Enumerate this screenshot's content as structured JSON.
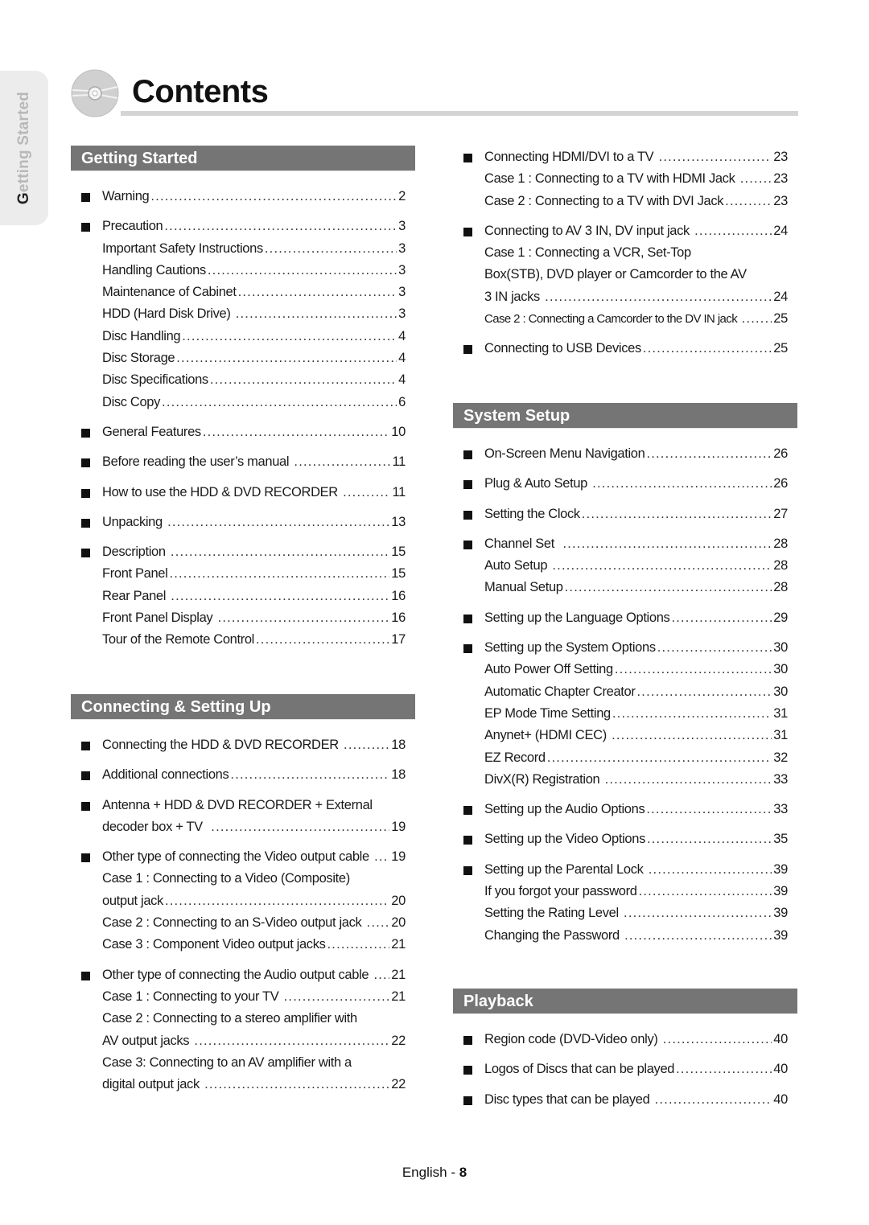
{
  "side_tab": {
    "first_letter": "G",
    "rest": "etting Started"
  },
  "title": "Contents",
  "columns": [
    {
      "sections": [
        {
          "header": "Getting Started",
          "groups": [
            {
              "lines": [
                {
                  "bullet": true,
                  "text": "Warning",
                  "page": "2"
                }
              ]
            },
            {
              "lines": [
                {
                  "bullet": true,
                  "text": "Precaution",
                  "page": "3"
                },
                {
                  "bullet": false,
                  "text": "Important Safety Instructions",
                  "page": "3"
                },
                {
                  "bullet": false,
                  "text": "Handling Cautions",
                  "page": "3"
                },
                {
                  "bullet": false,
                  "text": "Maintenance of Cabinet",
                  "page": "3"
                },
                {
                  "bullet": false,
                  "text": "HDD (Hard Disk Drive) ",
                  "page": "3"
                },
                {
                  "bullet": false,
                  "text": "Disc Handling",
                  "page": "4"
                },
                {
                  "bullet": false,
                  "text": "Disc Storage",
                  "page": "4"
                },
                {
                  "bullet": false,
                  "text": "Disc Specifications",
                  "page": "4"
                },
                {
                  "bullet": false,
                  "text": "Disc Copy",
                  "page": "6"
                }
              ]
            },
            {
              "lines": [
                {
                  "bullet": true,
                  "text": "General Features",
                  "page": "10"
                }
              ]
            },
            {
              "lines": [
                {
                  "bullet": true,
                  "text": "Before reading the user’s manual ",
                  "page": "11"
                }
              ]
            },
            {
              "lines": [
                {
                  "bullet": true,
                  "text": "How to use the HDD & DVD RECORDER ",
                  "page": "11"
                }
              ]
            },
            {
              "lines": [
                {
                  "bullet": true,
                  "text": "Unpacking ",
                  "page": "13"
                }
              ]
            },
            {
              "lines": [
                {
                  "bullet": true,
                  "text": "Description ",
                  "page": "15"
                },
                {
                  "bullet": false,
                  "text": "Front Panel",
                  "page": "15"
                },
                {
                  "bullet": false,
                  "text": "Rear Panel ",
                  "page": "16"
                },
                {
                  "bullet": false,
                  "text": "Front Panel Display ",
                  "page": "16"
                },
                {
                  "bullet": false,
                  "text": "Tour of the Remote Control",
                  "page": "17"
                }
              ]
            }
          ]
        },
        {
          "header": "Connecting & Setting Up",
          "groups": [
            {
              "lines": [
                {
                  "bullet": true,
                  "text": "Connecting the HDD & DVD RECORDER ",
                  "page": "18"
                }
              ]
            },
            {
              "lines": [
                {
                  "bullet": true,
                  "text": "Additional connections",
                  "page": "18"
                }
              ]
            },
            {
              "lines": [
                {
                  "bullet": true,
                  "text": "Antenna + HDD & DVD RECORDER + External",
                  "page": ""
                },
                {
                  "bullet": false,
                  "text": "decoder box + TV  ",
                  "page": "19"
                }
              ]
            },
            {
              "lines": [
                {
                  "bullet": true,
                  "text": "Other type of connecting the Video output cable ",
                  "page": "19"
                },
                {
                  "bullet": false,
                  "text": "Case 1 : Connecting to a Video (Composite)",
                  "page": ""
                },
                {
                  "bullet": false,
                  "text": "output jack",
                  "page": "20"
                },
                {
                  "bullet": false,
                  "text": "Case 2 : Connecting to an S-Video output jack ",
                  "page": "20"
                },
                {
                  "bullet": false,
                  "text": "Case 3 : Component Video output jacks",
                  "page": "21"
                }
              ]
            },
            {
              "lines": [
                {
                  "bullet": true,
                  "text": "Other type of connecting the Audio output cable ",
                  "page": "21"
                },
                {
                  "bullet": false,
                  "text": "Case 1 : Connecting to your TV ",
                  "page": "21"
                },
                {
                  "bullet": false,
                  "text": "Case 2 : Connecting to a stereo amplifier with",
                  "page": ""
                },
                {
                  "bullet": false,
                  "text": "AV output jacks ",
                  "page": "22"
                },
                {
                  "bullet": false,
                  "text": "Case 3: Connecting to an AV amplifier with a",
                  "page": ""
                },
                {
                  "bullet": false,
                  "text": "digital output jack ",
                  "page": "22"
                }
              ]
            }
          ]
        }
      ]
    },
    {
      "sections": [
        {
          "header": "",
          "groups": [
            {
              "lines": [
                {
                  "bullet": true,
                  "text": "Connecting HDMI/DVI to a TV ",
                  "page": "23"
                },
                {
                  "bullet": false,
                  "text": "Case 1 : Connecting to a TV with HDMI Jack ",
                  "page": "23"
                },
                {
                  "bullet": false,
                  "text": "Case 2 : Connecting to a TV with DVI Jack",
                  "page": "23"
                }
              ]
            },
            {
              "lines": [
                {
                  "bullet": true,
                  "text": "Connecting to AV 3 IN, DV input jack ",
                  "page": "24"
                },
                {
                  "bullet": false,
                  "text": "Case 1 : Connecting a VCR, Set-Top",
                  "page": ""
                },
                {
                  "bullet": false,
                  "text": "Box(STB), DVD player or Camcorder to the AV",
                  "page": ""
                },
                {
                  "bullet": false,
                  "text": "3 IN jacks ",
                  "page": "24"
                },
                {
                  "bullet": false,
                  "text": "Case 2 : Connecting a Camcorder to the DV IN jack ",
                  "page": "25",
                  "condensed": true
                }
              ]
            },
            {
              "lines": [
                {
                  "bullet": true,
                  "text": "Connecting to USB Devices",
                  "page": "25"
                }
              ]
            }
          ]
        },
        {
          "header": "System Setup",
          "groups": [
            {
              "lines": [
                {
                  "bullet": true,
                  "text": "On-Screen Menu Navigation",
                  "page": "26"
                }
              ]
            },
            {
              "lines": [
                {
                  "bullet": true,
                  "text": "Plug & Auto Setup ",
                  "page": "26"
                }
              ]
            },
            {
              "lines": [
                {
                  "bullet": true,
                  "text": "Setting the Clock",
                  "page": "27"
                }
              ]
            },
            {
              "lines": [
                {
                  "bullet": true,
                  "text": "Channel Set  ",
                  "page": "28"
                },
                {
                  "bullet": false,
                  "text": "Auto Setup ",
                  "page": "28"
                },
                {
                  "bullet": false,
                  "text": "Manual Setup",
                  "page": "28"
                }
              ]
            },
            {
              "lines": [
                {
                  "bullet": true,
                  "text": "Setting up the Language Options",
                  "page": "29"
                }
              ]
            },
            {
              "lines": [
                {
                  "bullet": true,
                  "text": "Setting up the System Options",
                  "page": "30"
                },
                {
                  "bullet": false,
                  "text": "Auto Power Off Setting",
                  "page": "30"
                },
                {
                  "bullet": false,
                  "text": "Automatic Chapter Creator",
                  "page": "30"
                },
                {
                  "bullet": false,
                  "text": "EP Mode Time Setting",
                  "page": "31"
                },
                {
                  "bullet": false,
                  "text": "Anynet+ (HDMI CEC) ",
                  "page": "31"
                },
                {
                  "bullet": false,
                  "text": "EZ Record",
                  "page": "32"
                },
                {
                  "bullet": false,
                  "text": "DivX(R) Registration ",
                  "page": "33"
                }
              ]
            },
            {
              "lines": [
                {
                  "bullet": true,
                  "text": "Setting up the Audio Options",
                  "page": "33"
                }
              ]
            },
            {
              "lines": [
                {
                  "bullet": true,
                  "text": "Setting up the Video Options",
                  "page": "35"
                }
              ]
            },
            {
              "lines": [
                {
                  "bullet": true,
                  "text": "Setting up the Parental Lock ",
                  "page": "39"
                },
                {
                  "bullet": false,
                  "text": "If you forgot your password",
                  "page": "39"
                },
                {
                  "bullet": false,
                  "text": "Setting the Rating Level ",
                  "page": "39"
                },
                {
                  "bullet": false,
                  "text": "Changing the Password ",
                  "page": "39"
                }
              ]
            }
          ]
        },
        {
          "header": "Playback",
          "groups": [
            {
              "lines": [
                {
                  "bullet": true,
                  "text": "Region code (DVD-Video only) ",
                  "page": "40"
                }
              ]
            },
            {
              "lines": [
                {
                  "bullet": true,
                  "text": "Logos of Discs that can be played",
                  "page": "40"
                }
              ]
            },
            {
              "lines": [
                {
                  "bullet": true,
                  "text": "Disc types that can be played ",
                  "page": "40"
                }
              ]
            }
          ]
        }
      ]
    }
  ],
  "footer": {
    "language": "English",
    "separator": " - ",
    "page_number": "8"
  }
}
